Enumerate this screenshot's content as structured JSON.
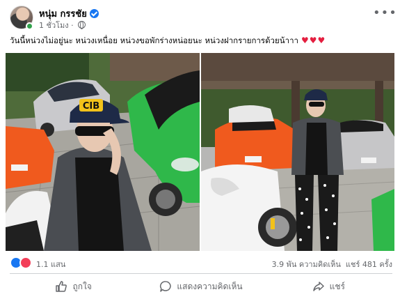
{
  "post": {
    "author": "หนุ่ม กรรชัย",
    "time": "1 ชั่วโมง",
    "caption": "วันนี้หน่วงไม่อยู่นะ หน่วงเหนื่อย หน่วงขอพักร่างหน่อยนะ หน่วงฝากรายการด้วยน้าาา",
    "caption_emoji": "♥♥♥",
    "more_label": "•••",
    "cap_text": "CIB"
  },
  "stats": {
    "reactions": "1.1 แสน",
    "comments": "3.9 พัน ความคิดเห็น",
    "shares": "แชร์ 481 ครั้ง"
  },
  "actions": {
    "like": "ถูกใจ",
    "comment": "แสดงความคิดเห็น",
    "share": "แชร์"
  },
  "icons": [
    "verified-badge-icon",
    "globe-icon",
    "more-options-icon",
    "like-reaction-icon",
    "love-reaction-icon",
    "thumbs-up-icon",
    "comment-bubble-icon",
    "share-arrow-icon"
  ],
  "colors": {
    "brand_blue": "#1877f2",
    "love_red": "#f33e58",
    "heart_red": "#e41e3f",
    "secondary_text": "#65676b",
    "green_car": "#2fb84a",
    "orange_car": "#f05a1e"
  }
}
